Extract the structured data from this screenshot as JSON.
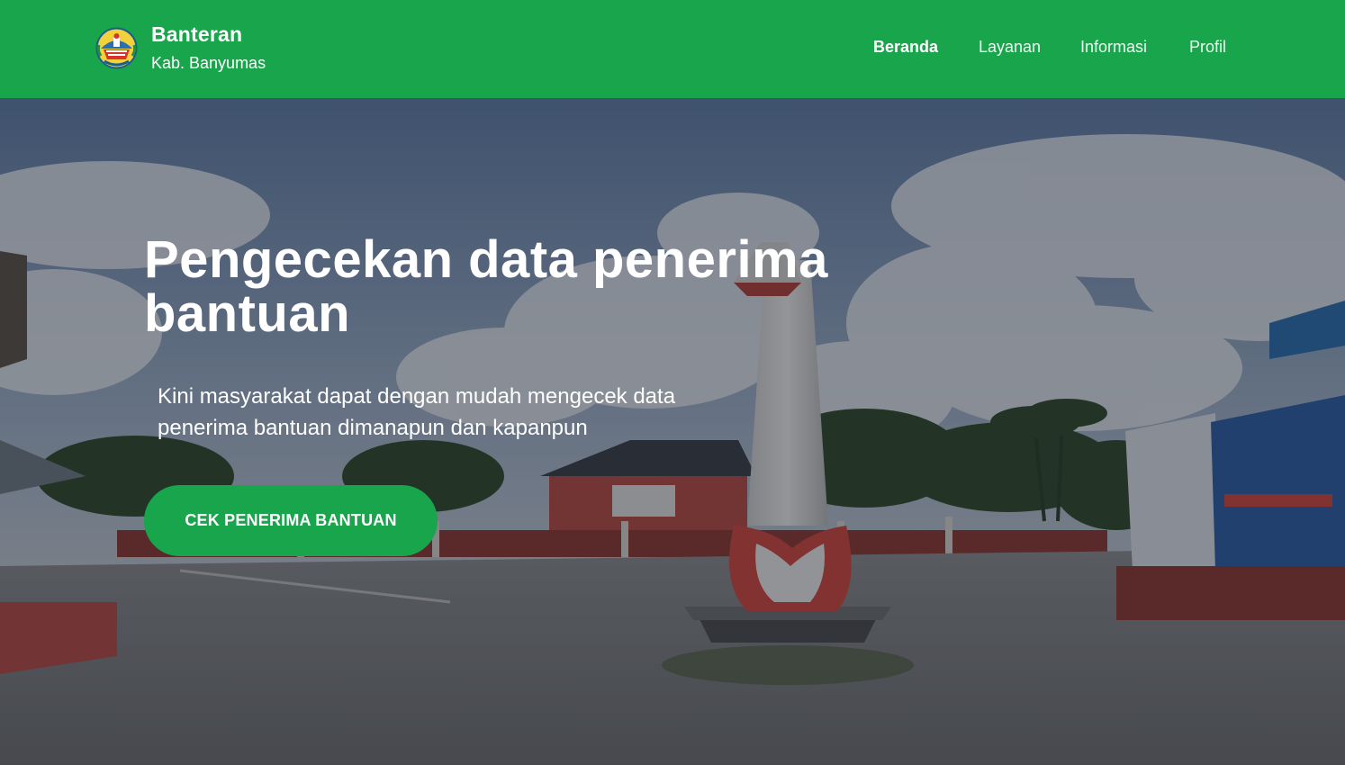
{
  "header": {
    "brand_title": "Banteran",
    "brand_subtitle": "Kab. Banyumas",
    "nav": [
      {
        "label": "Beranda",
        "active": true
      },
      {
        "label": "Layanan",
        "active": false
      },
      {
        "label": "Informasi",
        "active": false
      },
      {
        "label": "Profil",
        "active": false
      }
    ]
  },
  "hero": {
    "title": "Pengecekan data penerima bantuan",
    "description": "Kini masyarakat dapat dengan mudah mengecek data penerima bantuan dimanapun dan kapanpun",
    "cta_label": "CEK PENERIMA BANTUAN"
  },
  "colors": {
    "brand_green": "#18a54b",
    "text_white": "#ffffff"
  },
  "icons": {
    "logo": "banyumas-regency-emblem"
  }
}
